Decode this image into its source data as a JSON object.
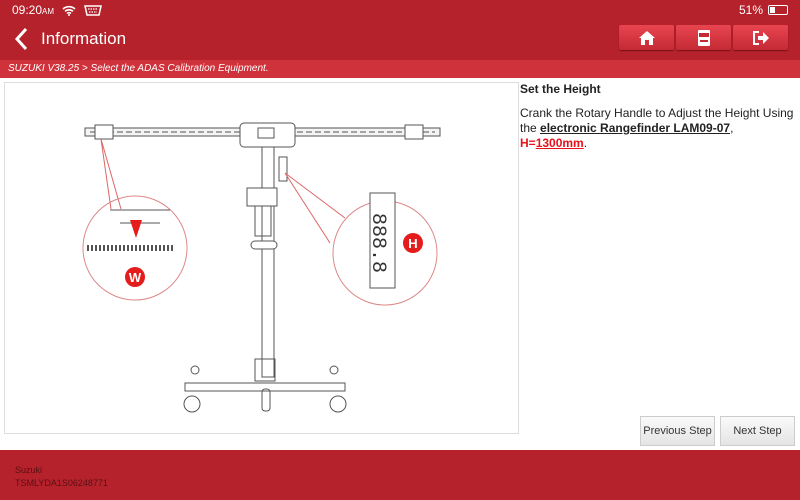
{
  "status": {
    "time": "09:20",
    "ampm": "AM",
    "battery": "51%"
  },
  "header": {
    "title": "Information",
    "buttons": [
      {
        "icon": "home-icon"
      },
      {
        "icon": "adas-icon",
        "label": "ADAS"
      },
      {
        "icon": "exit-icon"
      }
    ]
  },
  "breadcrumb": "SUZUKI V38.25 > Select the ADAS Calibration Equipment.",
  "image": {
    "labels": {
      "w": "W",
      "h": "H"
    }
  },
  "instructions": {
    "heading": "Set the Height",
    "text1": "Crank the Rotary Handle to Adjust the Height Using the ",
    "link": "electronic Rangefinder LAM09-07",
    "comma": ", ",
    "h_prefix": "H=",
    "h_value": "1300mm",
    "period": "."
  },
  "nav": {
    "previous": "Previous Step",
    "next": "Next Step"
  },
  "footer": {
    "make": "Suzuki",
    "vin": "TSMLYDA1S06248771"
  },
  "colors": {
    "header": "#b5222b",
    "breadcrumb": "#cf323b",
    "highlight": "#e8101a"
  }
}
